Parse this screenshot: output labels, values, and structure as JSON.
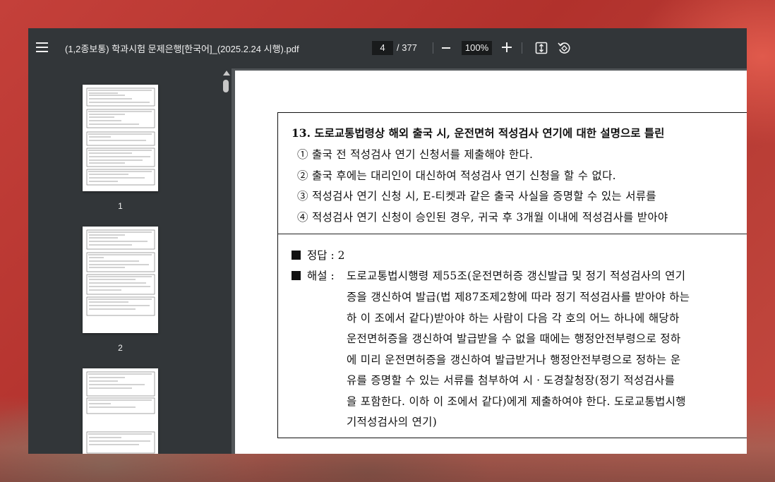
{
  "toolbar": {
    "title": "(1,2종보통) 학과시험 문제은행[한국어]_(2025.2.24 시행).pdf",
    "current_page": "4",
    "total_pages": "/ 377",
    "zoom": "100%",
    "icons": [
      "menu-icon",
      "zoom-out-icon",
      "zoom-in-icon",
      "fit-page-icon",
      "rotate-icon"
    ]
  },
  "sidebar": {
    "thumbnails": [
      {
        "label": "1"
      },
      {
        "label": "2"
      },
      {
        "label": ""
      }
    ]
  },
  "page": {
    "question": {
      "title": "13. 도로교통법령상 해외 출국 시, 운전면허 적성검사 연기에 대한 설명으로 틀린",
      "options": [
        "① 출국 전 적성검사 연기 신청서를 제출해야 한다.",
        "② 출국 후에는 대리인이 대신하여 적성검사 연기 신청을 할 수 없다.",
        "③ 적성검사 연기 신청 시, E-티켓과 같은 출국 사실을 증명할 수 있는 서류를",
        "④ 적성검사 연기 신청이 승인된 경우, 귀국 후 3개월 이내에 적성검사를 받아야"
      ]
    },
    "answer": {
      "answer_label": "정답 : 2",
      "explanation_label": "해설 :",
      "explanation_lines": [
        "도로교통법시행령 제55조(운전면허증 갱신발급 및 정기 적성검사의 연기",
        "증을 갱신하여 발급(법 제87조제2항에 따라 정기 적성검사를 받아야 하는",
        "하 이 조에서 같다)받아야 하는 사람이 다음 각 호의 어느 하나에 해당하",
        "운전면허증을 갱신하여 발급받을 수 없을 때에는 행정안전부령으로 정하",
        "에 미리 운전면허증을 갱신하여 발급받거나 행정안전부령으로 정하는 운",
        "유를 증명할 수 있는 서류를 첨부하여 시ㆍ도경찰청장(정기 적성검사를",
        "을 포함한다. 이하 이 조에서 같다)에게 제출하여야 한다. 도로교통법시행",
        "기적성검사의 연기)"
      ]
    }
  }
}
